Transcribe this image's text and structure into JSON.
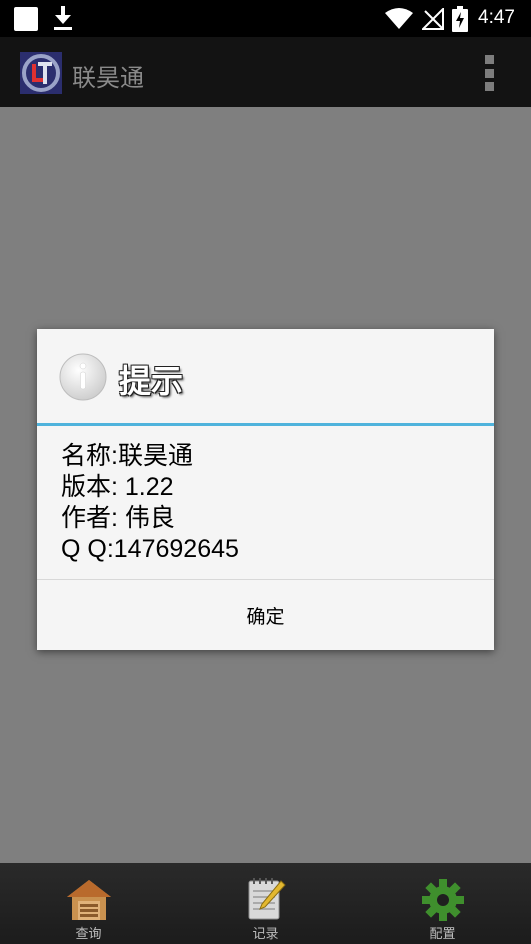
{
  "status_bar": {
    "time": "4:47",
    "icons": [
      "notification-square-icon",
      "download-icon",
      "wifi-icon",
      "no-signal-icon",
      "battery-charging-icon"
    ]
  },
  "action_bar": {
    "title": "联昊通",
    "logo": "app-logo-icon",
    "overflow": "overflow-menu-icon"
  },
  "dialog": {
    "title": "提示",
    "icon": "info-icon",
    "lines": [
      "名称:联昊通",
      "版本: 1.22",
      "作者: 伟良",
      "Q Q:147692645"
    ],
    "ok_label": "确定",
    "accent": "#4fb3dc"
  },
  "bottom_nav": {
    "items": [
      {
        "label": "查询",
        "icon": "house-icon"
      },
      {
        "label": "记录",
        "icon": "notepad-icon"
      },
      {
        "label": "配置",
        "icon": "gear-icon"
      }
    ]
  },
  "colors": {
    "content_background": "#7f7f7f",
    "action_bar": "#131313",
    "dialog_background": "#f5f5f5"
  }
}
